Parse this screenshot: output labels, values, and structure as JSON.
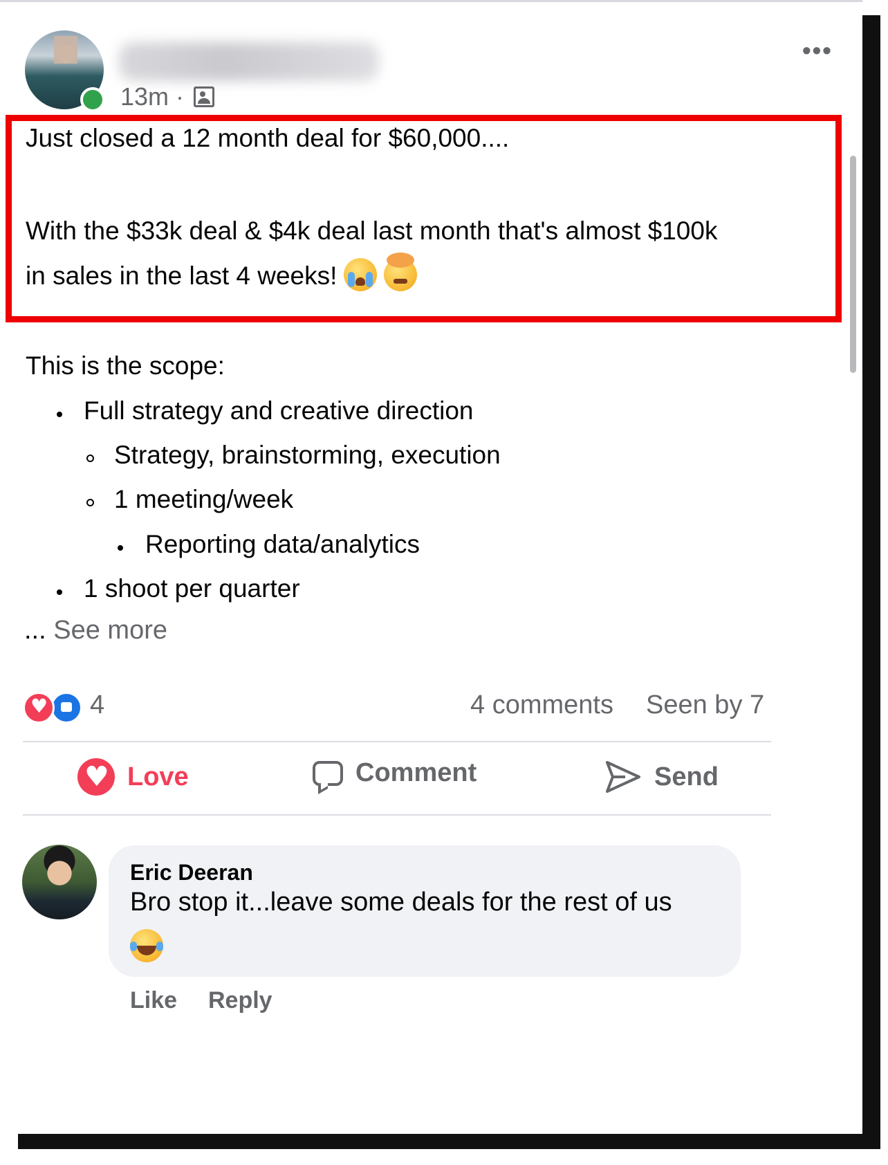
{
  "post": {
    "author_name": "[name redacted]",
    "time": "13m",
    "separator": "·",
    "audience_icon": "friends-audience-icon",
    "more_label": "•••",
    "highlighted_lines": [
      "Just closed a 12 month deal for $60,000....",
      "With the $33k deal & $4k deal last month that's almost $100k",
      "in sales in the last 4 weeks!"
    ],
    "highlight_color": "#ee0000",
    "scope_heading": "This is the scope:",
    "scope_items": [
      "Full strategy and creative direction",
      "Strategy, brainstorming, execution",
      "1 meeting/week",
      "Reporting data/analytics",
      "1 shoot per quarter"
    ],
    "see_more_ellipsis": "...",
    "see_more": "See more"
  },
  "stats": {
    "reaction_count": "4",
    "comments": "4 comments",
    "seen_by": "Seen by 7"
  },
  "actions": {
    "love": "Love",
    "comment": "Comment",
    "send": "Send"
  },
  "comment": {
    "author": "Eric Deeran",
    "text": "Bro stop it...leave some deals for the rest of us",
    "like": "Like",
    "reply": "Reply"
  },
  "colors": {
    "love": "#f33e58",
    "like": "#1b74e4",
    "online": "#31a24c",
    "secondary_text": "#65676b",
    "bubble": "#f0f2f5"
  }
}
